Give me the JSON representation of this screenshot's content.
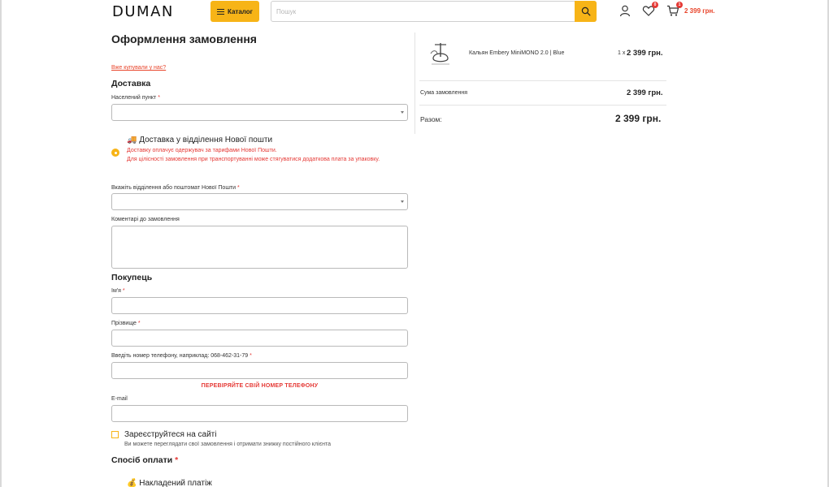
{
  "header": {
    "logo": "DUMAN",
    "catalog_label": "Каталог",
    "search_placeholder": "Пошук",
    "wishlist_count": "0",
    "cart_count": "1",
    "cart_total": "2 399 грн.",
    "icons": [
      "menu-icon",
      "search-icon",
      "user-icon",
      "heart-icon",
      "cart-icon"
    ]
  },
  "form": {
    "title": "Оформлення замовлення",
    "login_link": "Вже купували у нас?",
    "delivery": {
      "heading": "Доставка",
      "city_label": "Населений пункт",
      "option_title": "🚚 Доставка у відділення Нової пошти",
      "option_note_1": "Доставку оплачує одержувач за тарифами Нової Пошти.",
      "option_note_2": "Для цілісності замовлення при транспортуванні може стягуватися додаткова плата за упаковку.",
      "branch_label": "Вкажіть відділення або поштомат Нової Пошти",
      "comment_label": "Коментарі до замовлення"
    },
    "buyer": {
      "heading": "Покупець",
      "first_name_label": "Ім'я",
      "last_name_label": "Прізвище",
      "phone_label": "Введіть номер телефону, наприклад: 068-462-31-79",
      "phone_warning": "ПЕРЕВІРЯЙТЕ СВІЙ НОМЕР ТЕЛЕФОНУ",
      "email_label": "E-mail"
    },
    "register": {
      "label": "Зареєструйтеся на сайті",
      "note": "Ви можете переглядати свої замовлення і отримати знижку постійного клієнта"
    },
    "payment": {
      "heading": "Спосіб оплати",
      "option": "💰 Накладений платіж"
    },
    "required_mark": "*"
  },
  "summary": {
    "product_name": "Кальян Embery MiniMONO 2.0 | Blue",
    "product_qty": "1 x",
    "product_price": "2 399 грн.",
    "order_sum_label": "Сума замовлення",
    "order_sum_value": "2 399 грн.",
    "total_label": "Разом:",
    "total_value": "2 399 грн."
  },
  "colors": {
    "accent": "#f7b417",
    "error": "#e53935",
    "price_orange": "#e8442a"
  }
}
